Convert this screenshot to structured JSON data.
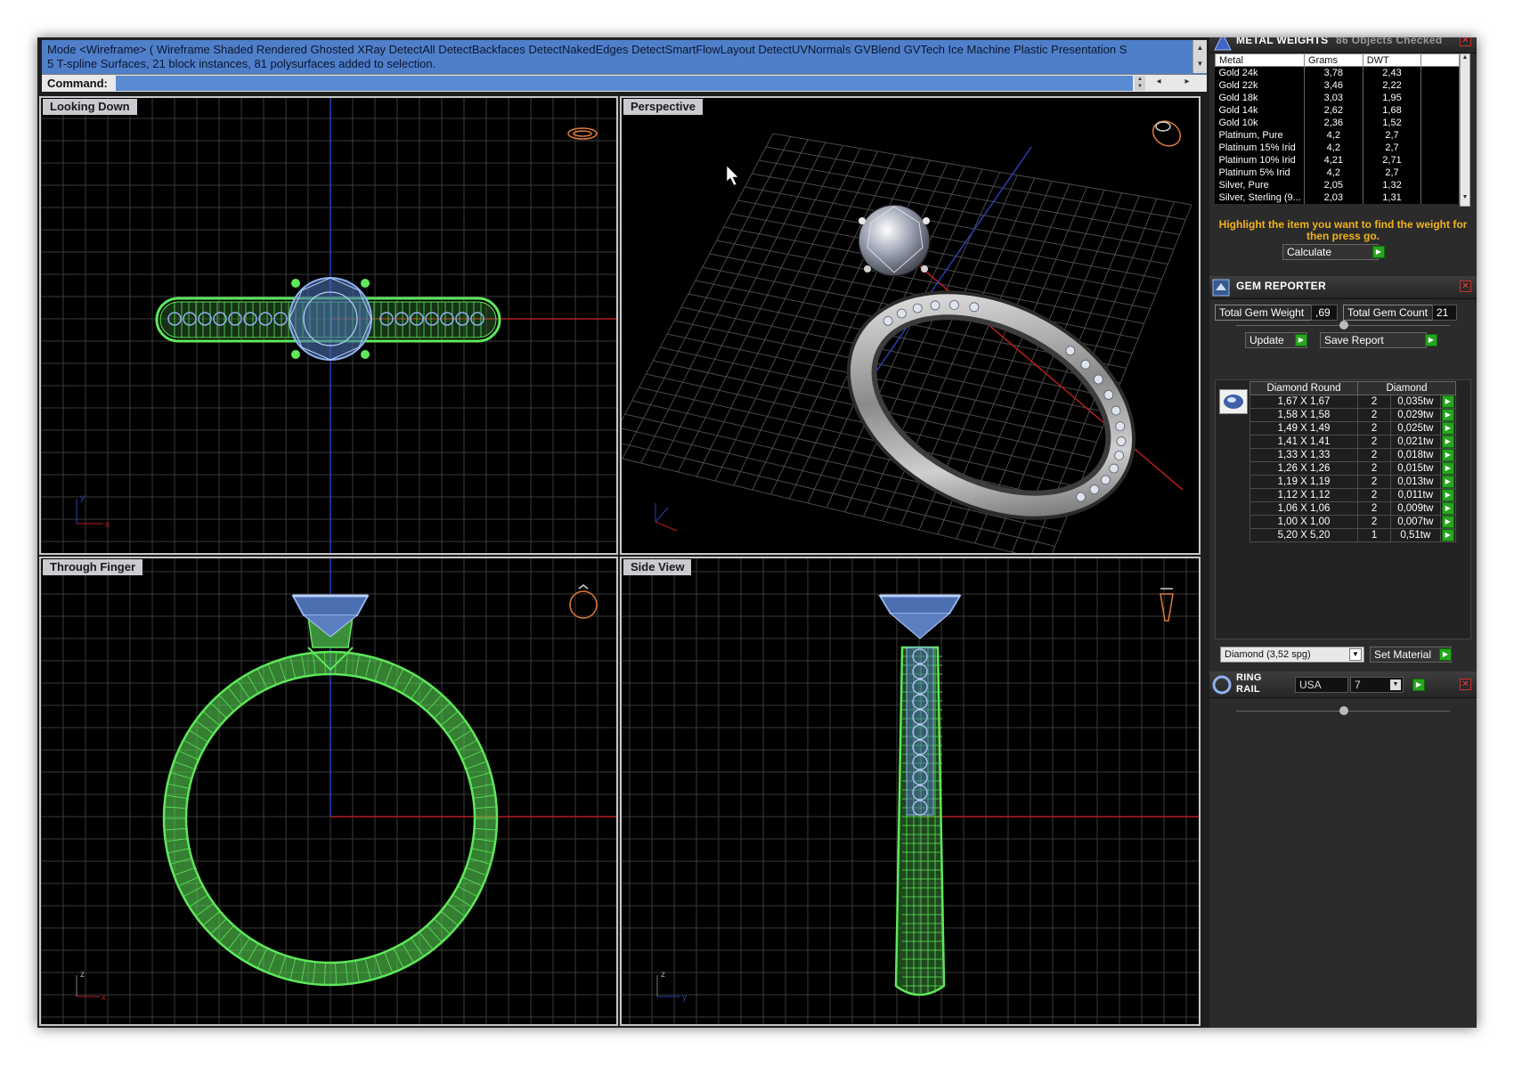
{
  "command": {
    "history": [
      "Mode <Wireframe> ( Wireframe  Shaded  Rendered  Ghosted  XRay  DetectAll  DetectBackfaces  DetectNakedEdges  DetectSmartFlowLayout  DetectUVNormals  GVBlend  GVTech  Ice  Machine  Plastic  Presentation  S",
      "5 T-spline Surfaces, 21 block instances, 81 polysurfaces added to selection."
    ],
    "prompt_label": "Command:"
  },
  "viewports": {
    "top": {
      "title": "Looking Down"
    },
    "perspective": {
      "title": "Perspective"
    },
    "front": {
      "title": "Through Finger"
    },
    "side": {
      "title": "Side View"
    }
  },
  "axis_labels": {
    "x": "x",
    "y": "y",
    "z": "z"
  },
  "metal_weights": {
    "title": "METAL WEIGHTS",
    "objects_checked": "86 Objects Checked",
    "columns": [
      "Metal",
      "Grams",
      "DWT"
    ],
    "rows": [
      [
        "Gold 24k",
        "3,78",
        "2,43"
      ],
      [
        "Gold 22k",
        "3,46",
        "2,22"
      ],
      [
        "Gold 18k",
        "3,03",
        "1,95"
      ],
      [
        "Gold 14k",
        "2,62",
        "1,68"
      ],
      [
        "Gold 10k",
        "2,36",
        "1,52"
      ],
      [
        "Platinum, Pure",
        "4,2",
        "2,7"
      ],
      [
        "Platinum 15% Irid",
        "4,2",
        "2,7"
      ],
      [
        "Platinum 10% Irid",
        "4,21",
        "2,71"
      ],
      [
        "Platinum 5% Irid",
        "4,2",
        "2,7"
      ],
      [
        "Silver, Pure",
        "2,05",
        "1,32"
      ],
      [
        "Silver, Sterling (9...",
        "2,03",
        "1,31"
      ]
    ],
    "hint": "Highlight the item you want to find the weight for then press go.",
    "calculate_label": "Calculate"
  },
  "gem_reporter": {
    "title": "GEM REPORTER",
    "total_weight_label": "Total Gem Weight",
    "total_weight_value": ",69",
    "total_count_label": "Total Gem Count",
    "total_count_value": "21",
    "update_label": "Update",
    "save_report_label": "Save Report",
    "columns": [
      "Diamond Round",
      "Diamond"
    ],
    "rows": [
      [
        "1,67 X 1,67",
        "2",
        "0,035tw"
      ],
      [
        "1,58 X 1,58",
        "2",
        "0,029tw"
      ],
      [
        "1,49 X 1,49",
        "2",
        "0,025tw"
      ],
      [
        "1,41 X 1,41",
        "2",
        "0,021tw"
      ],
      [
        "1,33 X 1,33",
        "2",
        "0,018tw"
      ],
      [
        "1,26 X 1,26",
        "2",
        "0,015tw"
      ],
      [
        "1,19 X 1,19",
        "2",
        "0,013tw"
      ],
      [
        "1,12 X 1,12",
        "2",
        "0,011tw"
      ],
      [
        "1,06 X 1,06",
        "2",
        "0,009tw"
      ],
      [
        "1,00 X 1,00",
        "2",
        "0,007tw"
      ],
      [
        "5,20 X 5,20",
        "1",
        "0,51tw"
      ]
    ],
    "material_select": "Diamond    (3,52 spg)",
    "set_material_label": "Set Material"
  },
  "ring_rail": {
    "title_line1": "RING",
    "title_line2": "RAIL",
    "region": "USA",
    "size": "7"
  },
  "colors": {
    "wire_green": "#5ee85a",
    "wire_blue": "#8fb2f0",
    "grid": "#3a3a3a",
    "axis_x": "#b51f1f",
    "axis_y": "#2a3fb6",
    "accent_orange": "#e07a3a"
  }
}
